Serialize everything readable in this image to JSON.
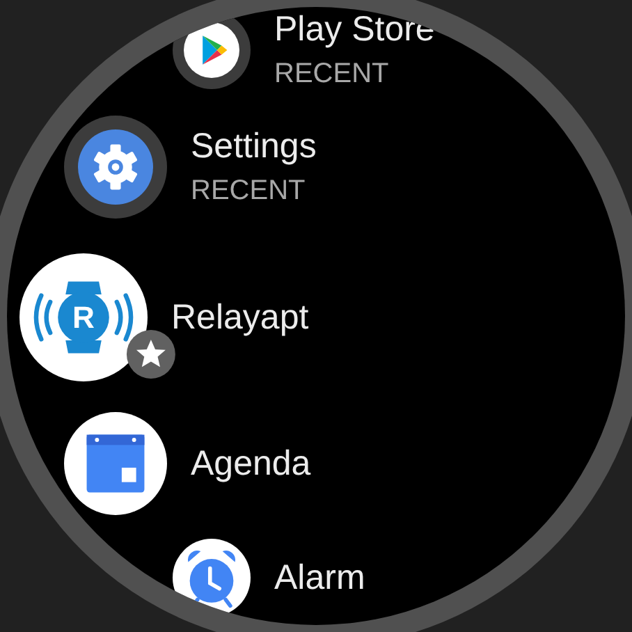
{
  "apps": [
    {
      "name": "Play Store",
      "subtitle": "RECENT",
      "kind": "recent",
      "favorite": false
    },
    {
      "name": "Settings",
      "subtitle": "RECENT",
      "kind": "recent",
      "favorite": false
    },
    {
      "name": "Relayapt",
      "kind": "app",
      "logo_letter": "R",
      "favorite": true
    },
    {
      "name": "Agenda",
      "kind": "app",
      "favorite": false
    },
    {
      "name": "Alarm",
      "kind": "app",
      "favorite": false
    }
  ]
}
